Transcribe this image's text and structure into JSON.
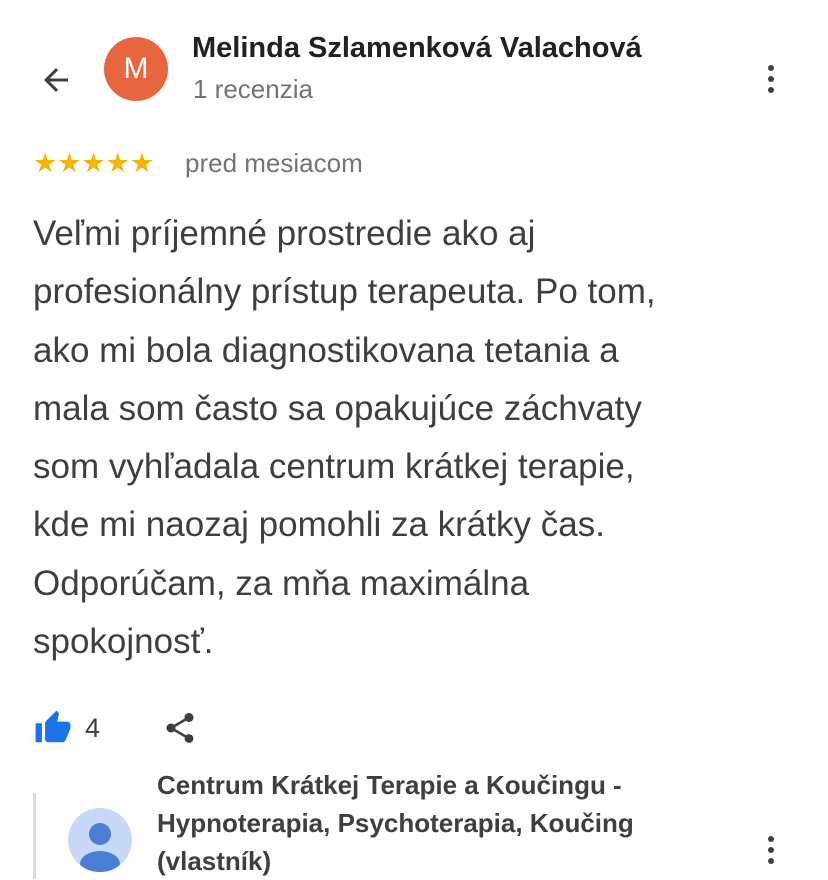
{
  "header": {
    "back_icon": "arrow-left-icon",
    "avatar_letter": "M",
    "avatar_color": "#e8663f",
    "reviewer_name": "Melinda Szlamenková Valachová",
    "review_count": "1 recenzia",
    "more_icon": "more-vertical-icon"
  },
  "review": {
    "rating": 5,
    "stars": "★★★★★",
    "star_color": "#f4b400",
    "relative_time": "pred mesiacom",
    "text_lines": [
      "Veľmi príjemné prostredie ako aj",
      "profesionálny prístup terapeuta. Po tom,",
      "ako mi bola diagnostikovana tetania a",
      "mala som často sa opakujúce záchvaty",
      "som vyhľadala centrum krátkej terapie,",
      "kde mi naozaj pomohli za krátky čas.",
      "Odporúčam, za mňa maximálna",
      "spokojnosť."
    ]
  },
  "actions": {
    "like_icon": "thumbs-up-icon",
    "like_color": "#1a73e8",
    "like_count": "4",
    "share_icon": "share-icon"
  },
  "owner_response": {
    "avatar_icon": "person-icon",
    "name_lines": [
      "Centrum Krátkej Terapie a Koučingu -",
      "Hypnoterapia, Psychoterapia, Koučing"
    ],
    "role": "(vlastník)",
    "more_icon": "more-vertical-icon"
  }
}
